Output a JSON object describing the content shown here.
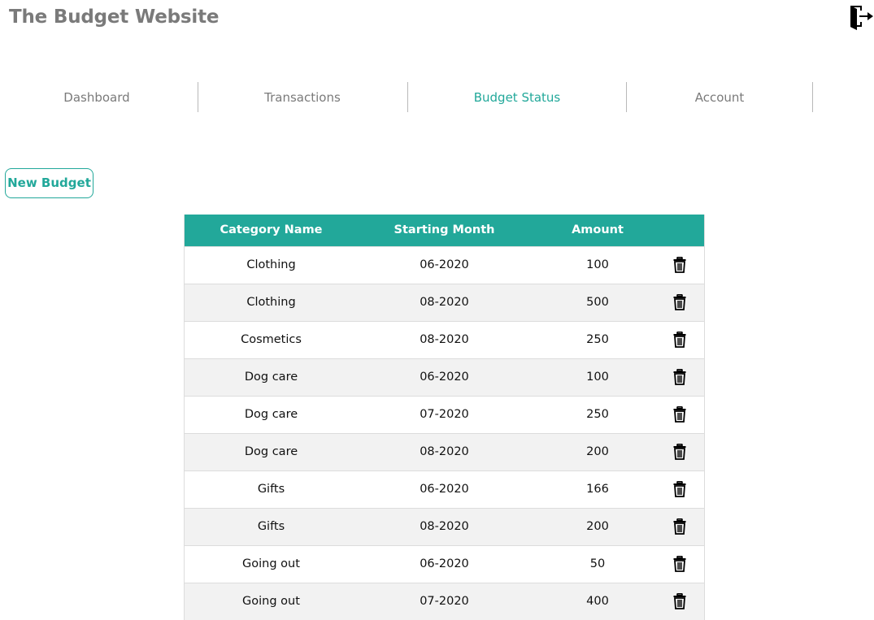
{
  "header": {
    "title": "The Budget Website",
    "logout_icon": "logout-door-icon"
  },
  "nav": {
    "items": [
      {
        "label": "Dashboard",
        "active": false
      },
      {
        "label": "Transactions",
        "active": false
      },
      {
        "label": "Budget Status",
        "active": true
      },
      {
        "label": "Account",
        "active": false
      }
    ]
  },
  "actions": {
    "new_budget_label": "New Budget"
  },
  "table": {
    "headers": {
      "category": "Category Name",
      "month": "Starting Month",
      "amount": "Amount"
    },
    "rows": [
      {
        "category": "Clothing",
        "month": "06-2020",
        "amount": "100"
      },
      {
        "category": "Clothing",
        "month": "08-2020",
        "amount": "500"
      },
      {
        "category": "Cosmetics",
        "month": "08-2020",
        "amount": "250"
      },
      {
        "category": "Dog care",
        "month": "06-2020",
        "amount": "100"
      },
      {
        "category": "Dog care",
        "month": "07-2020",
        "amount": "250"
      },
      {
        "category": "Dog care",
        "month": "08-2020",
        "amount": "200"
      },
      {
        "category": "Gifts",
        "month": "06-2020",
        "amount": "166"
      },
      {
        "category": "Gifts",
        "month": "08-2020",
        "amount": "200"
      },
      {
        "category": "Going out",
        "month": "06-2020",
        "amount": "50"
      },
      {
        "category": "Going out",
        "month": "07-2020",
        "amount": "400"
      }
    ],
    "delete_icon": "trash-icon"
  },
  "colors": {
    "accent": "#22a89a",
    "text_muted": "#7a7a7a",
    "row_alt": "#f2f2f2"
  }
}
